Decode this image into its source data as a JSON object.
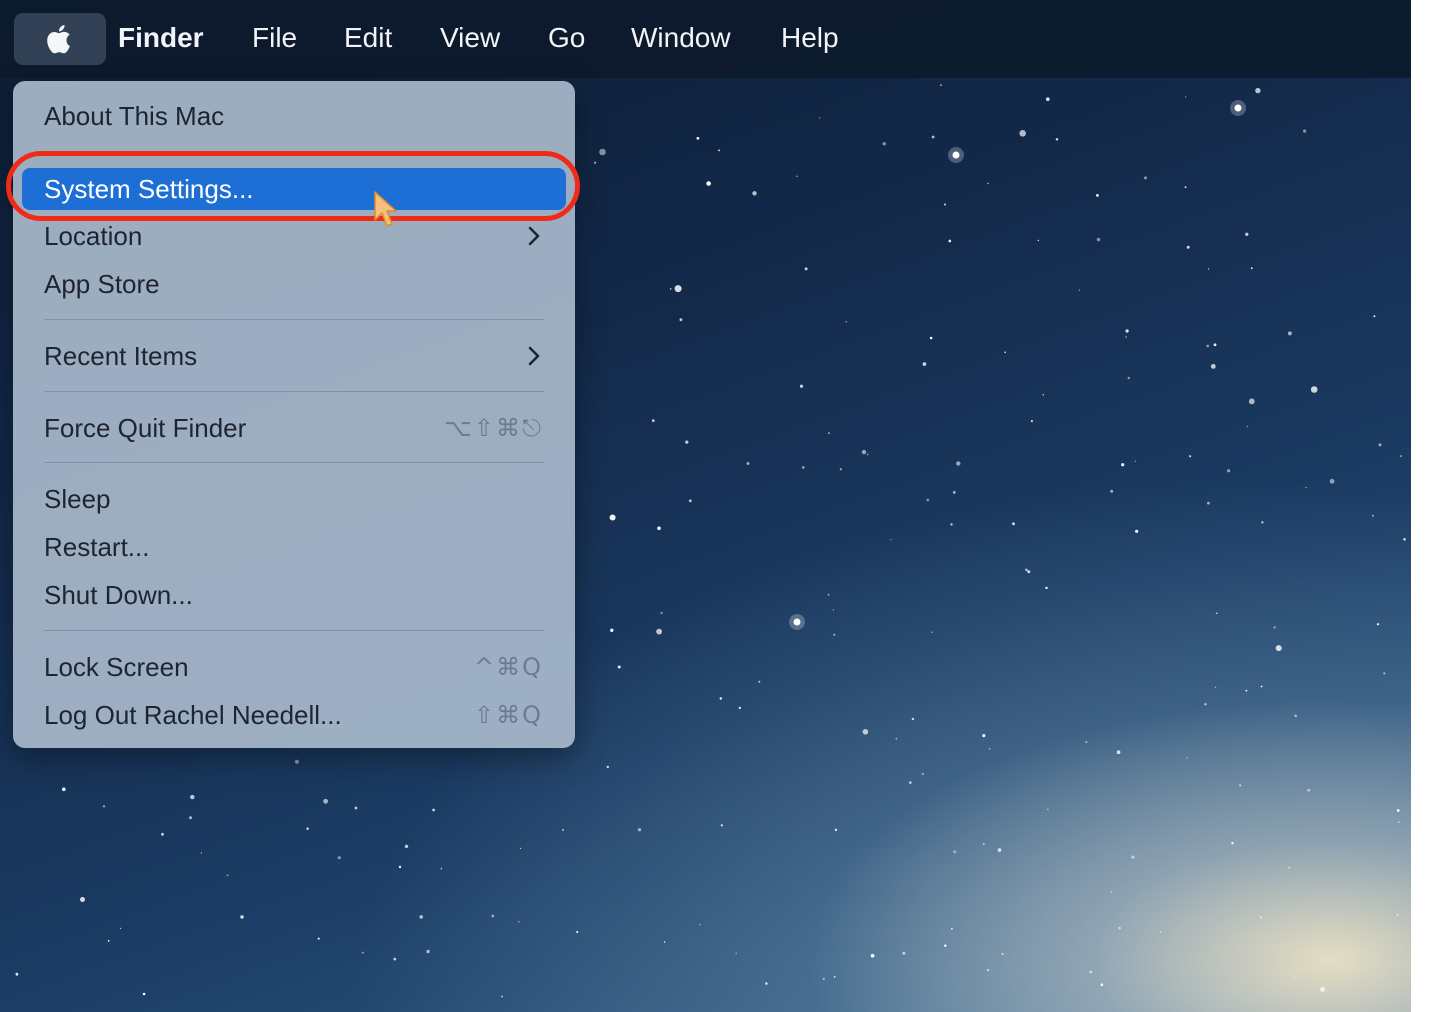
{
  "menubar": {
    "apple_icon": "apple-logo-icon",
    "items": [
      {
        "label": "Finder",
        "bold": true
      },
      {
        "label": "File"
      },
      {
        "label": "Edit"
      },
      {
        "label": "View"
      },
      {
        "label": "Go"
      },
      {
        "label": "Window"
      },
      {
        "label": "Help"
      }
    ]
  },
  "apple_menu": {
    "about": "About This Mac",
    "system_settings": "System Settings...",
    "location": "Location",
    "app_store": "App Store",
    "recent_items": "Recent Items",
    "force_quit": "Force Quit Finder",
    "force_quit_shortcut": "⌥⇧⌘⎋",
    "sleep": "Sleep",
    "restart": "Restart...",
    "shut_down": "Shut Down...",
    "lock_screen": "Lock Screen",
    "lock_screen_shortcut": "^⌘Q",
    "log_out": "Log Out Rachel Needell...",
    "log_out_shortcut": "⇧⌘Q",
    "highlighted_item": "System Settings..."
  },
  "colors": {
    "highlight": "#1d6fd6",
    "callout": "#ef2b17"
  }
}
